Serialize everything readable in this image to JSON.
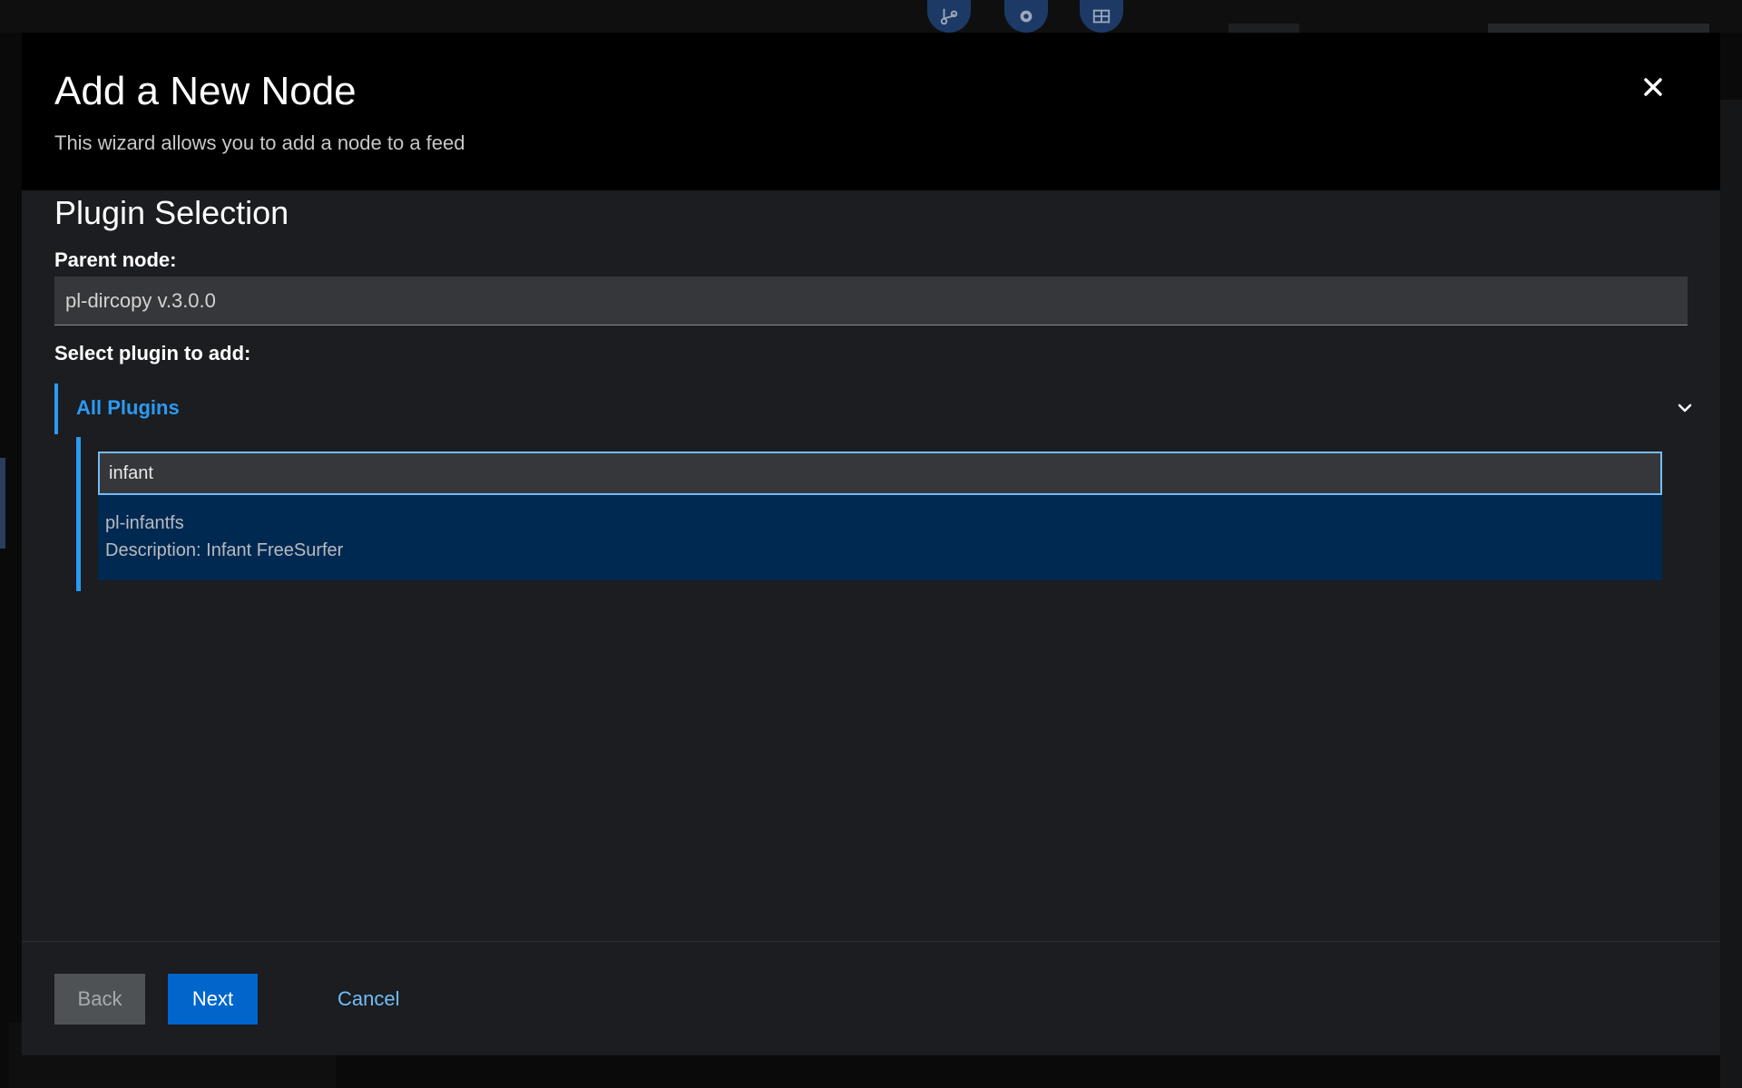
{
  "background": {
    "topbar_icons": [
      "git-branch-icon",
      "gear-icon",
      "table-icon"
    ]
  },
  "modal": {
    "title": "Add a New Node",
    "subtitle": "This wizard allows you to add a node to a feed",
    "close_icon": "close-icon"
  },
  "plugin_selection": {
    "heading": "Plugin Selection",
    "parent_label": "Parent node:",
    "parent_value": "pl-dircopy v.3.0.0",
    "select_label": "Select plugin to add:",
    "expandable_label": "All Plugins",
    "search_value": "infant",
    "results": [
      {
        "name": "pl-infantfs",
        "description": "Description: Infant FreeSurfer"
      }
    ]
  },
  "footer": {
    "back_label": "Back",
    "next_label": "Next",
    "cancel_label": "Cancel"
  },
  "colors": {
    "accent": "#2b9af3",
    "primary_button": "#0066cc",
    "selected_item": "#002952"
  }
}
